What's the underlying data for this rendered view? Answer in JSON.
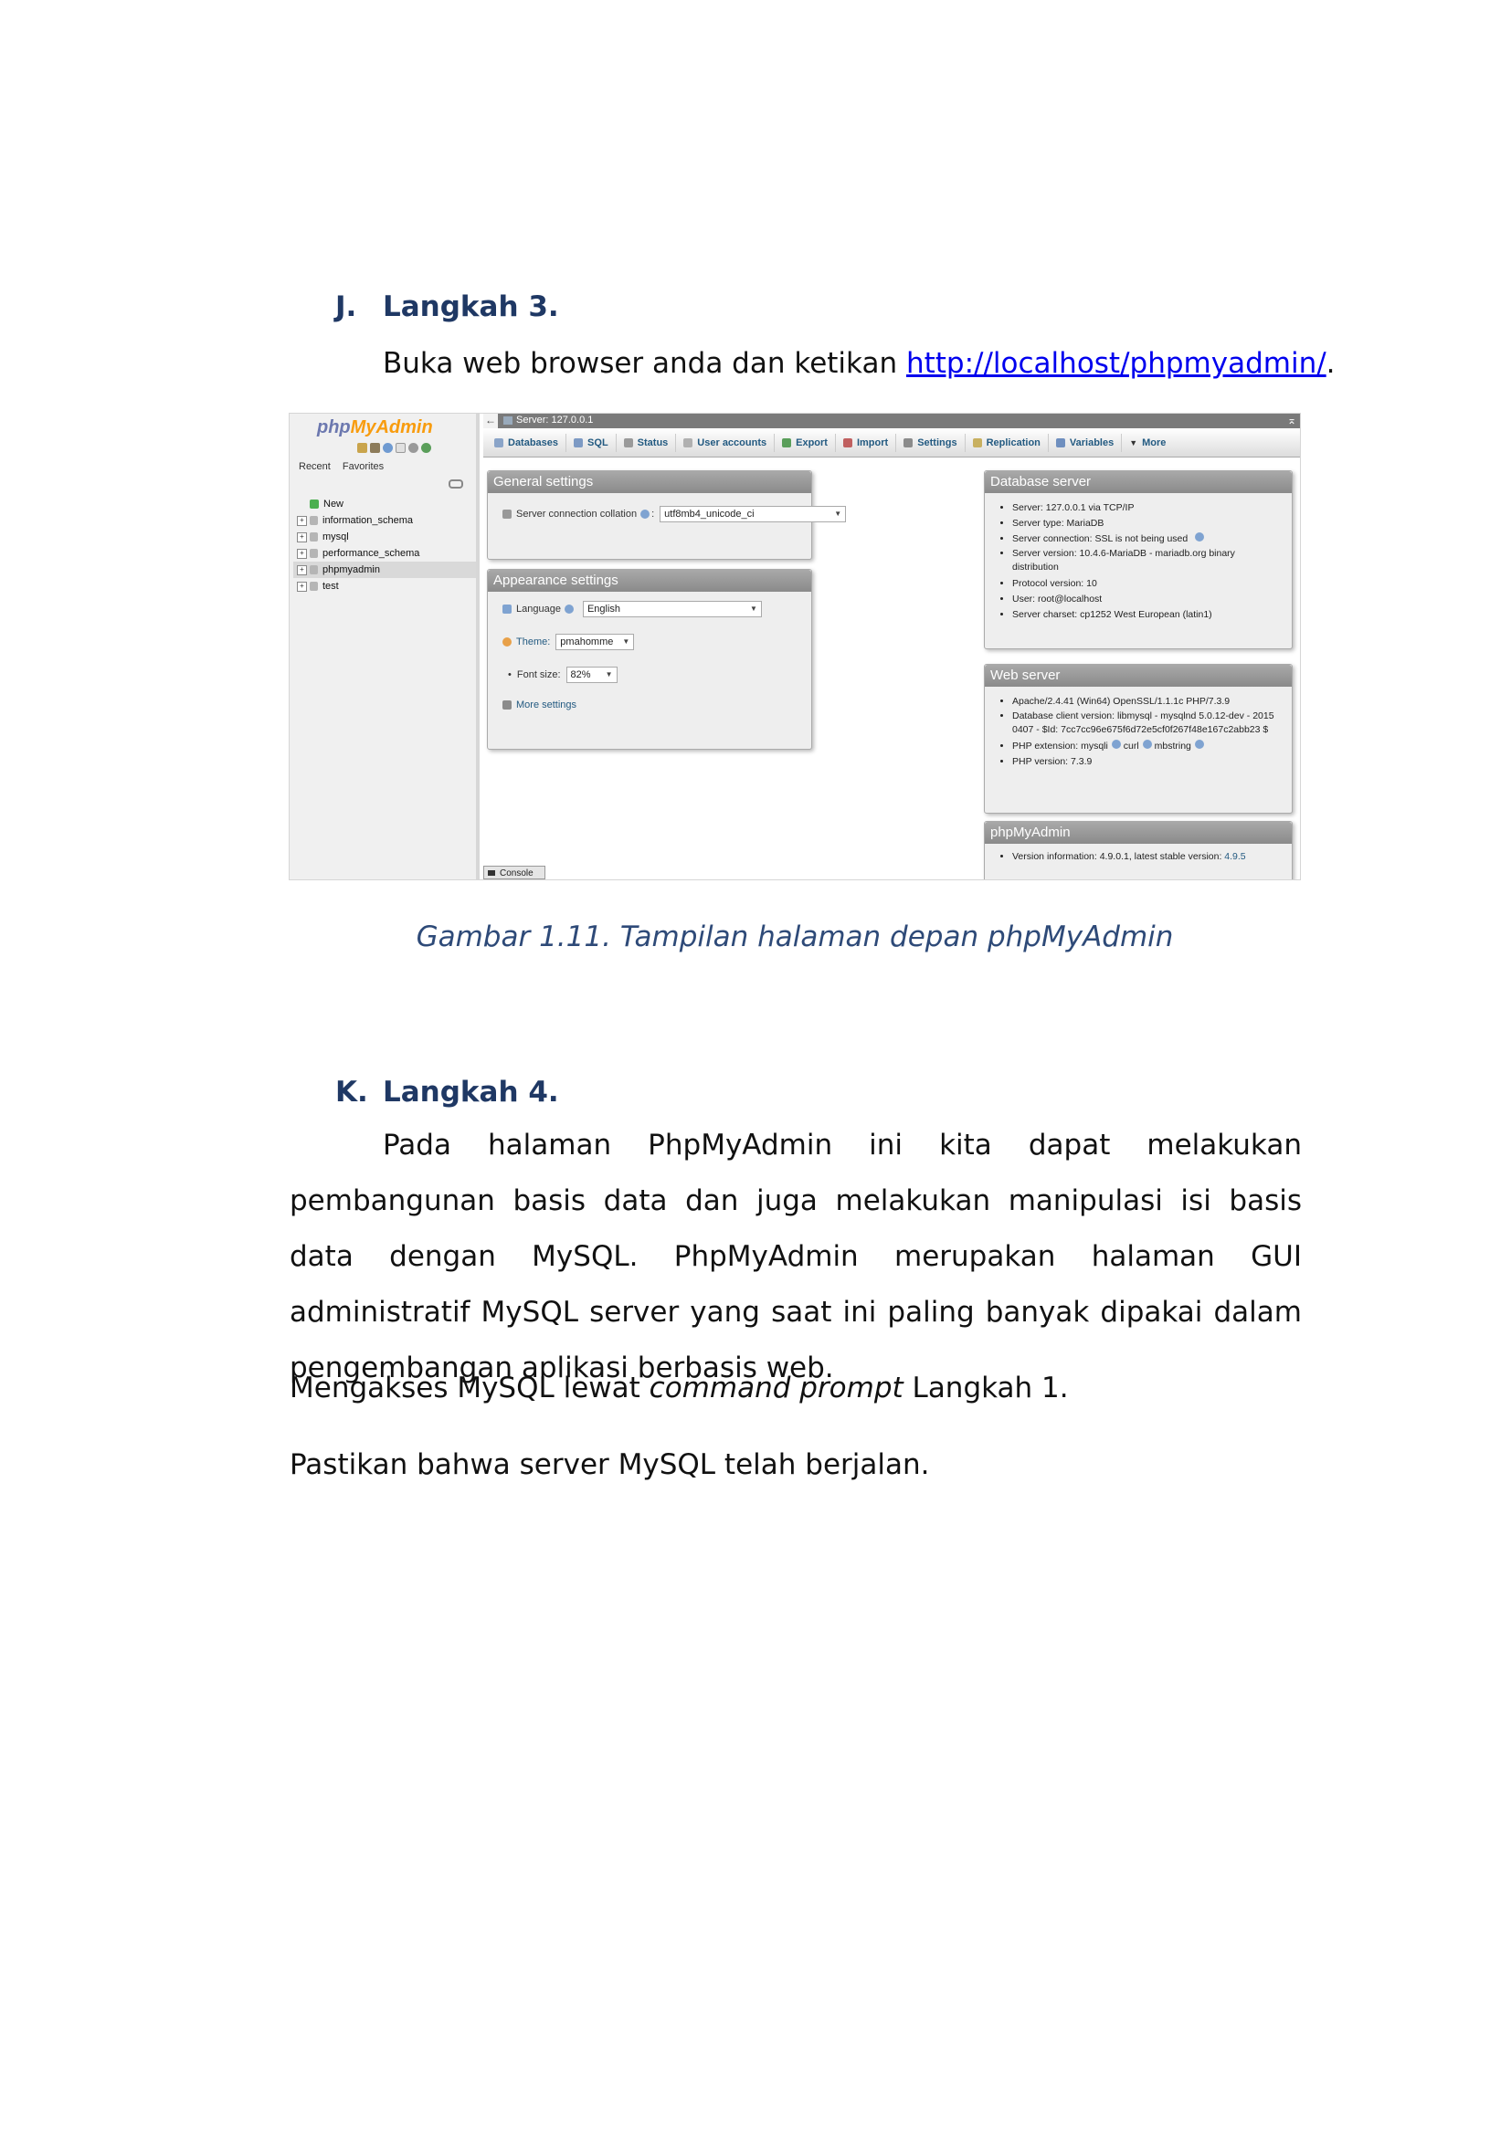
{
  "step_j": {
    "letter": "J.",
    "title": "Langkah 3.",
    "text_before": "Buka web browser anda dan ketikan ",
    "link": "http://localhost/phpmyadmin/",
    "text_after": "."
  },
  "figure": {
    "caption": "Gambar 1.11. Tampilan halaman depan phpMyAdmin",
    "screenshot": {
      "logo": {
        "part1": "php",
        "part2": "MyAdmin"
      },
      "nav_links": [
        "Recent",
        "Favorites"
      ],
      "tree": [
        {
          "label": "New",
          "icon": "new-icon"
        },
        {
          "label": "information_schema",
          "icon": "database-icon"
        },
        {
          "label": "mysql",
          "icon": "database-icon"
        },
        {
          "label": "performance_schema",
          "icon": "database-icon"
        },
        {
          "label": "phpmyadmin",
          "icon": "database-icon"
        },
        {
          "label": "test",
          "icon": "database-icon"
        }
      ],
      "server_label": "Server: 127.0.0.1",
      "tabs": [
        {
          "label": "Databases",
          "color": "#8aa4c8"
        },
        {
          "label": "SQL",
          "color": "#7d9ac4"
        },
        {
          "label": "Status",
          "color": "#9a9a9a"
        },
        {
          "label": "User accounts",
          "color": "#b0b0b0"
        },
        {
          "label": "Export",
          "color": "#5a9e5a"
        },
        {
          "label": "Import",
          "color": "#c06060"
        },
        {
          "label": "Settings",
          "color": "#8b8b8b"
        },
        {
          "label": "Replication",
          "color": "#c8b060"
        },
        {
          "label": "Variables",
          "color": "#6f8fbf"
        },
        {
          "label": "More",
          "color": "#333333"
        }
      ],
      "general_settings": {
        "title": "General settings",
        "collation_label": "Server connection collation",
        "collation_value": "utf8mb4_unicode_ci"
      },
      "appearance_settings": {
        "title": "Appearance settings",
        "language_label": "Language",
        "language_value": "English",
        "theme_label": "Theme:",
        "theme_value": "pmahomme",
        "font_size_label": "Font size:",
        "font_size_value": "82%",
        "more_settings": "More settings"
      },
      "database_server": {
        "title": "Database server",
        "items": [
          "Server: 127.0.0.1 via TCP/IP",
          "Server type: MariaDB",
          "Server connection: SSL is not being used",
          "Server version: 10.4.6-MariaDB - mariadb.org binary distribution",
          "Protocol version: 10",
          "User: root@localhost",
          "Server charset: cp1252 West European (latin1)"
        ]
      },
      "web_server": {
        "title": "Web server",
        "items": [
          "Apache/2.4.41 (Win64) OpenSSL/1.1.1c PHP/7.3.9",
          "Database client version: libmysql - mysqlnd 5.0.12-dev - 20150407 - $Id: 7cc7cc96e675f6d72e5cf0f267f48e167c2abb23 $",
          "PHP extension: mysqli",
          "PHP version: 7.3.9"
        ],
        "ext_curl": "curl",
        "ext_mbstring": "mbstring"
      },
      "phpmyadmin_panel": {
        "title": "phpMyAdmin",
        "version_text": "Version information: 4.9.0.1, latest stable version: ",
        "version_link": "4.9.5"
      },
      "console": "Console"
    }
  },
  "step_k": {
    "letter": "K.",
    "title": "Langkah 4.",
    "paragraph": "Pada halaman PhpMyAdmin ini kita dapat melakukan pembangunan basis data dan juga melakukan manipulasi isi basis data dengan MySQL. PhpMyAdmin merupakan halaman GUI administratif MySQL server yang saat ini paling banyak dipakai dalam pengembangan aplikasi berbasis web.",
    "line2_before": "Mengakses MySQL lewat ",
    "line2_italic": "command prompt",
    "line2_after": " Langkah 1.",
    "line3": "Pastikan bahwa server MySQL telah berjalan."
  }
}
